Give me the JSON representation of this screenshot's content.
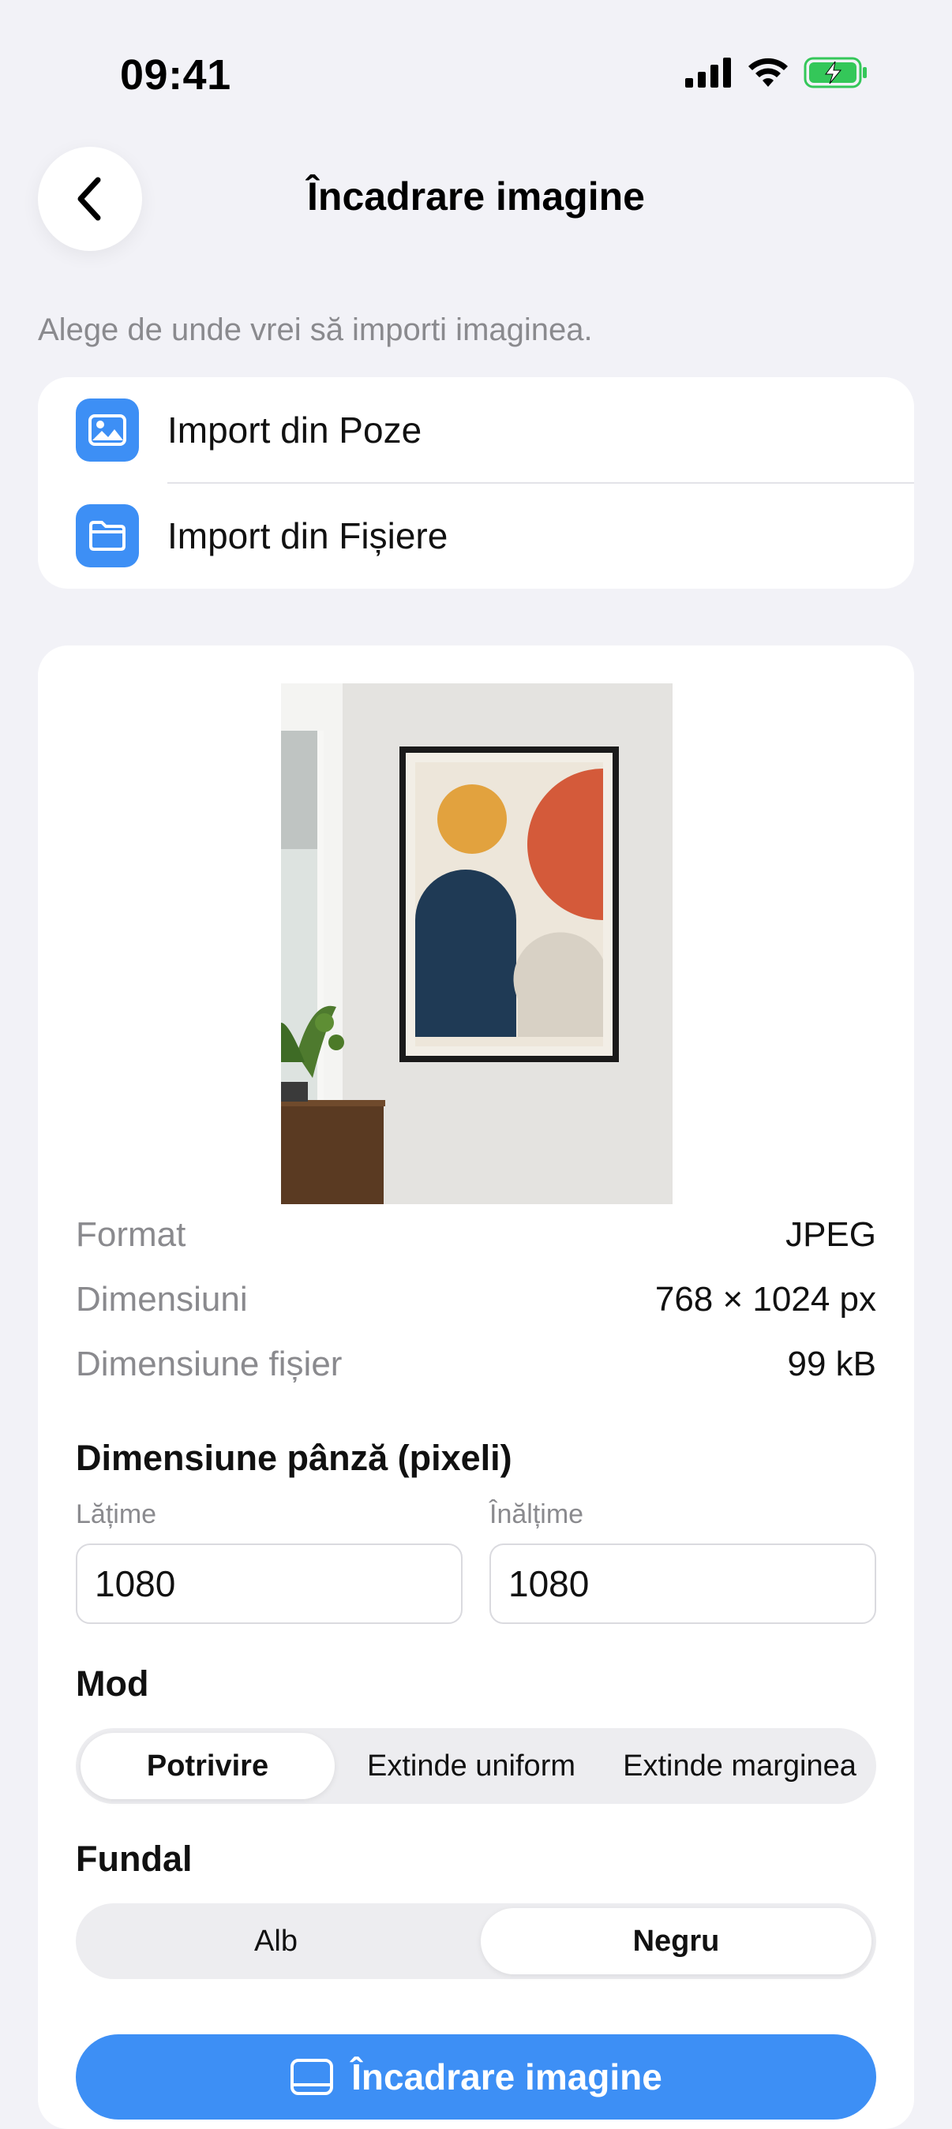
{
  "status_bar": {
    "time": "09:41"
  },
  "nav": {
    "title": "Încadrare imagine"
  },
  "import": {
    "hint": "Alege de unde vrei să importi imaginea.",
    "items": [
      {
        "label": "Import din Poze",
        "icon": "photo-icon"
      },
      {
        "label": "Import din Fișiere",
        "icon": "folder-icon"
      }
    ]
  },
  "info": {
    "rows": [
      {
        "key": "Format",
        "value": "JPEG"
      },
      {
        "key": "Dimensiuni",
        "value": "768 × 1024 px"
      },
      {
        "key": "Dimensiune fișier",
        "value": "99 kB"
      }
    ]
  },
  "canvas": {
    "title": "Dimensiune pânză (pixeli)",
    "width_label": "Lățime",
    "height_label": "Înălțime",
    "width_value": "1080",
    "height_value": "1080"
  },
  "mode": {
    "title": "Mod",
    "options": [
      "Potrivire",
      "Extinde uniform",
      "Extinde marginea"
    ],
    "selected": "Potrivire"
  },
  "background": {
    "title": "Fundal",
    "options": [
      "Alb",
      "Negru"
    ],
    "selected": "Negru"
  },
  "action": {
    "label": "Încadrare imagine"
  },
  "colors": {
    "accent": "#3D8FF5",
    "page_bg": "#F2F2F7",
    "battery": "#34C759"
  }
}
